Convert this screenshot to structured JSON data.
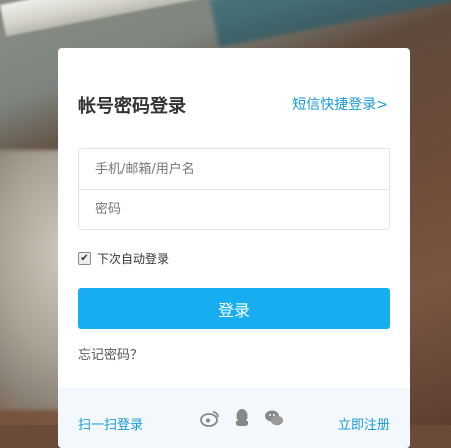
{
  "login": {
    "title": "帐号密码登录",
    "sms_login_link": "短信快捷登录>",
    "username_placeholder": "手机/邮箱/用户名",
    "password_placeholder": "密码",
    "remember_label": "下次自动登录",
    "remember_checked": true,
    "submit_label": "登录",
    "forgot_label": "忘记密码？"
  },
  "footer": {
    "scan_label": "扫一扫登录",
    "register_label": "立即注册",
    "social_icons": [
      "weibo-icon",
      "qq-icon",
      "wechat-icon"
    ]
  },
  "colors": {
    "accent": "#16aef0",
    "link": "#1a9ad6"
  }
}
